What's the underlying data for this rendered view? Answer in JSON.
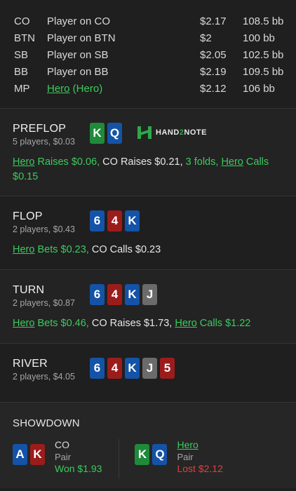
{
  "players": [
    {
      "pos": "CO",
      "name": "Player on CO",
      "stack": "$2.17",
      "bb": "108.5 bb"
    },
    {
      "pos": "BTN",
      "name": "Player on BTN",
      "stack": "$2",
      "bb": "100 bb"
    },
    {
      "pos": "SB",
      "name": "Player on SB",
      "stack": "$2.05",
      "bb": "102.5 bb"
    },
    {
      "pos": "BB",
      "name": "Player on BB",
      "stack": "$2.19",
      "bb": "109.5 bb"
    },
    {
      "pos": "MP",
      "name_link": "Hero",
      "name_suffix": " (Hero)",
      "stack": "$2.12",
      "bb": "106 bb"
    }
  ],
  "preflop": {
    "title": "PREFLOP",
    "sub": "5 players, $0.03",
    "cards": [
      {
        "v": "K",
        "c": "#1f8a3a"
      },
      {
        "v": "Q",
        "c": "#1453a8"
      }
    ],
    "logo": {
      "part1": "HAND",
      "part2": "2",
      "part3": "NOTE"
    },
    "action": {
      "a1_name": "Hero",
      "a1_text": " Raises $0.06,",
      "a2_name": " CO",
      "a2_text": " Raises $0.21,",
      "a3_text": " 3 folds, ",
      "a4_name": "Hero",
      "a4_text": " Calls $0.15"
    }
  },
  "flop": {
    "title": "FLOP",
    "sub": "2 players, $0.43",
    "cards": [
      {
        "v": "6",
        "c": "#1453a8"
      },
      {
        "v": "4",
        "c": "#9c1c1c"
      },
      {
        "v": "K",
        "c": "#1453a8"
      }
    ],
    "action": {
      "a1_name": "Hero",
      "a1_text": " Bets $0.23,",
      "a2_name": " CO",
      "a2_text": " Calls $0.23"
    }
  },
  "turn": {
    "title": "TURN",
    "sub": "2 players, $0.87",
    "cards": [
      {
        "v": "6",
        "c": "#1453a8"
      },
      {
        "v": "4",
        "c": "#9c1c1c"
      },
      {
        "v": "K",
        "c": "#1453a8"
      },
      {
        "v": "J",
        "c": "#6b6b6b"
      }
    ],
    "action": {
      "a1_name": "Hero",
      "a1_text": " Bets $0.46,",
      "a2_name": " CO",
      "a2_text": " Raises $1.73,",
      "a3_name": "Hero",
      "a3_text": " Calls $1.22"
    }
  },
  "river": {
    "title": "RIVER",
    "sub": "2 players, $4.05",
    "cards": [
      {
        "v": "6",
        "c": "#1453a8"
      },
      {
        "v": "4",
        "c": "#9c1c1c"
      },
      {
        "v": "K",
        "c": "#1453a8"
      },
      {
        "v": "J",
        "c": "#6b6b6b"
      },
      {
        "v": "5",
        "c": "#9c1c1c"
      }
    ]
  },
  "showdown": {
    "title": "SHOWDOWN",
    "players": [
      {
        "cards": [
          {
            "v": "A",
            "c": "#1453a8"
          },
          {
            "v": "K",
            "c": "#9c1c1c"
          }
        ],
        "name": "CO",
        "hand": "Pair",
        "result": "Won $1.93",
        "is_hero": false,
        "won": true
      },
      {
        "cards": [
          {
            "v": "K",
            "c": "#1f8a3a"
          },
          {
            "v": "Q",
            "c": "#1453a8"
          }
        ],
        "name": "Hero",
        "hand": "Pair",
        "result": "Lost $2.12",
        "is_hero": true,
        "won": false
      }
    ]
  }
}
